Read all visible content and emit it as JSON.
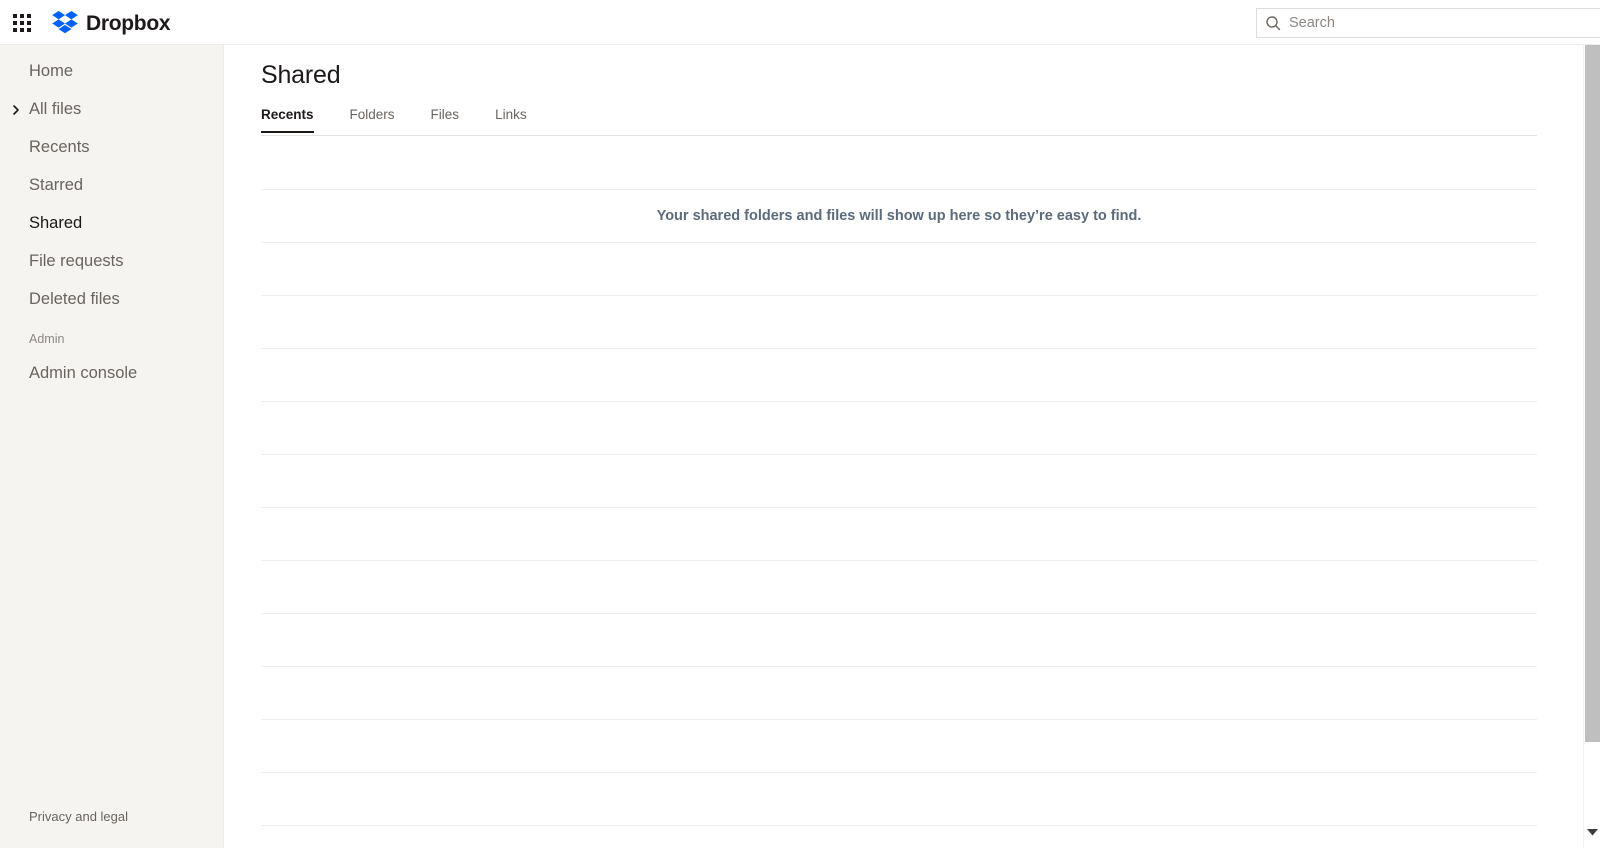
{
  "header": {
    "apps_grid_icon": "apps-grid-icon",
    "brand_name": "Dropbox",
    "brand_logo_icon": "dropbox-logo-icon",
    "search": {
      "icon": "search-icon",
      "placeholder": "Search",
      "value": ""
    }
  },
  "sidebar": {
    "items": [
      {
        "label": "Home",
        "active": false,
        "has_chevron": false
      },
      {
        "label": "All files",
        "active": false,
        "has_chevron": true
      },
      {
        "label": "Recents",
        "active": false,
        "has_chevron": false
      },
      {
        "label": "Starred",
        "active": false,
        "has_chevron": false
      },
      {
        "label": "Shared",
        "active": true,
        "has_chevron": false
      },
      {
        "label": "File requests",
        "active": false,
        "has_chevron": false
      },
      {
        "label": "Deleted files",
        "active": false,
        "has_chevron": false
      }
    ],
    "section_label": "Admin",
    "admin_items": [
      {
        "label": "Admin console",
        "active": false,
        "has_chevron": false
      }
    ],
    "footer_link": "Privacy and legal"
  },
  "main": {
    "title": "Shared",
    "tabs": [
      {
        "label": "Recents",
        "active": true
      },
      {
        "label": "Folders",
        "active": false
      },
      {
        "label": "Files",
        "active": false
      },
      {
        "label": "Links",
        "active": false
      }
    ],
    "empty_message": "Your shared folders and files will show up here so they’re easy to find.",
    "empty_rows_before_message": 1,
    "empty_rows_after_message": 11
  },
  "scrollbar": {
    "down_arrow_icon": "chevron-down-icon"
  },
  "colors": {
    "brand_blue": "#0061fe",
    "sidebar_bg": "#f5f4f1",
    "text_primary": "#1e1919",
    "text_muted": "#6a645f",
    "empty_text": "#5b6b7c",
    "divider": "#f0efed",
    "scroll_thumb": "#bfbfbf"
  }
}
